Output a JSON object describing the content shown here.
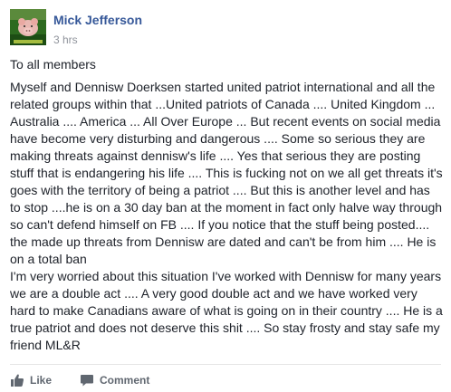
{
  "post": {
    "author": "Mick Jefferson",
    "time": "3 hrs",
    "greeting": "To all members",
    "body": "Myself and Dennisw Doerksen started united patriot international and all the related groups within that ...United patriots of Canada .... United Kingdom ... Australia .... America ... All Over Europe ... But recent events on social media have become very disturbing and dangerous .... Some so serious they are making threats against dennisw's life .... Yes that serious they are posting stuff that is endangering his life .... This is fucking not on we all get threats it's goes with the territory of being a patriot .... But this is another level and has to stop ....he is on a 30 day ban at the moment in fact only halve way through so can't defend himself on FB .... If you notice that the stuff being posted.... the made up threats from Dennisw are dated and can't be from him .... He is on a total ban\nI'm very worried about this situation I've worked with Dennisw for many years we are a double act .... A very good double act and we have worked very hard to make Canadians aware of what is going on in their country .... He is a true patriot and does not deserve this shit .... So stay frosty and stay safe my friend ML&R"
  },
  "actions": {
    "like_label": "Like",
    "comment_label": "Comment",
    "like_icon": "thumbs-up-icon",
    "comment_icon": "comment-bubble-icon"
  },
  "colors": {
    "author": "#365899",
    "text": "#1d2129",
    "meta": "#90949c",
    "action": "#606770"
  }
}
